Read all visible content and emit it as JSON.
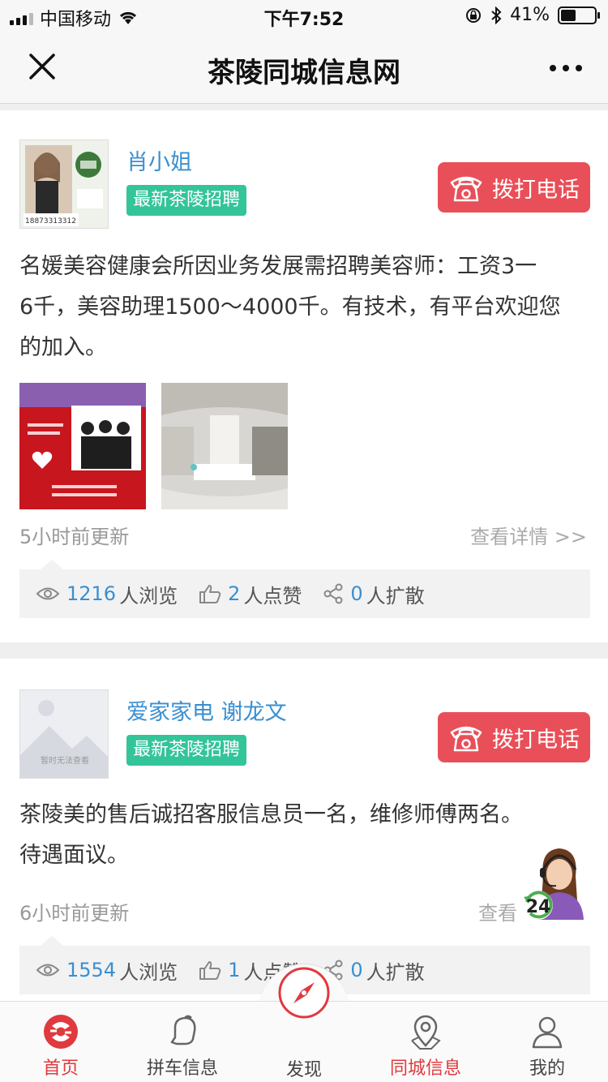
{
  "status_bar": {
    "carrier": "中国移动",
    "time": "下午7:52",
    "battery": "41%"
  },
  "nav": {
    "title": "茶陵同城信息网"
  },
  "posts": [
    {
      "name": "肖小姐",
      "tag": "最新茶陵招聘",
      "call": "拨打电话",
      "desc_lines": [
        "名媛美容健康会所因业务发展需招聘美容师：工资3一",
        "6千，美容助理1500～4000千。有技术，有平台欢迎您",
        "的加入。"
      ],
      "avatar_phone": "18873313312",
      "updated": "5小时前更新",
      "detail": "查看详情 >>",
      "views": "1216",
      "views_label": "人浏览",
      "likes": "2",
      "likes_label": "人点赞",
      "shares": "0",
      "shares_label": "人扩散"
    },
    {
      "name": "爱家家电 谢龙文",
      "tag": "最新茶陵招聘",
      "call": "拨打电话",
      "desc_lines": [
        "茶陵美的售后诚招客服信息员一名，维修师傅两名。",
        "待遇面议。"
      ],
      "avatar_text": "暂时无法查看",
      "updated": "6小时前更新",
      "detail": "查看",
      "views": "1554",
      "views_label": "人浏览",
      "likes": "1",
      "likes_label": "人点赞",
      "shares": "0",
      "shares_label": "人扩散"
    }
  ],
  "assistant_badge": "24",
  "tabbar": [
    {
      "label": "首页",
      "icon": "home-icon"
    },
    {
      "label": "拼车信息",
      "icon": "bell-icon"
    },
    {
      "label": "发现",
      "icon": "compass-icon"
    },
    {
      "label": "同城信息",
      "icon": "location-icon"
    },
    {
      "label": "我的",
      "icon": "user-icon"
    }
  ],
  "colors": {
    "accent": "#e0393e",
    "link": "#3a8fd0",
    "tag": "#33c49a",
    "call": "#e94f58"
  }
}
